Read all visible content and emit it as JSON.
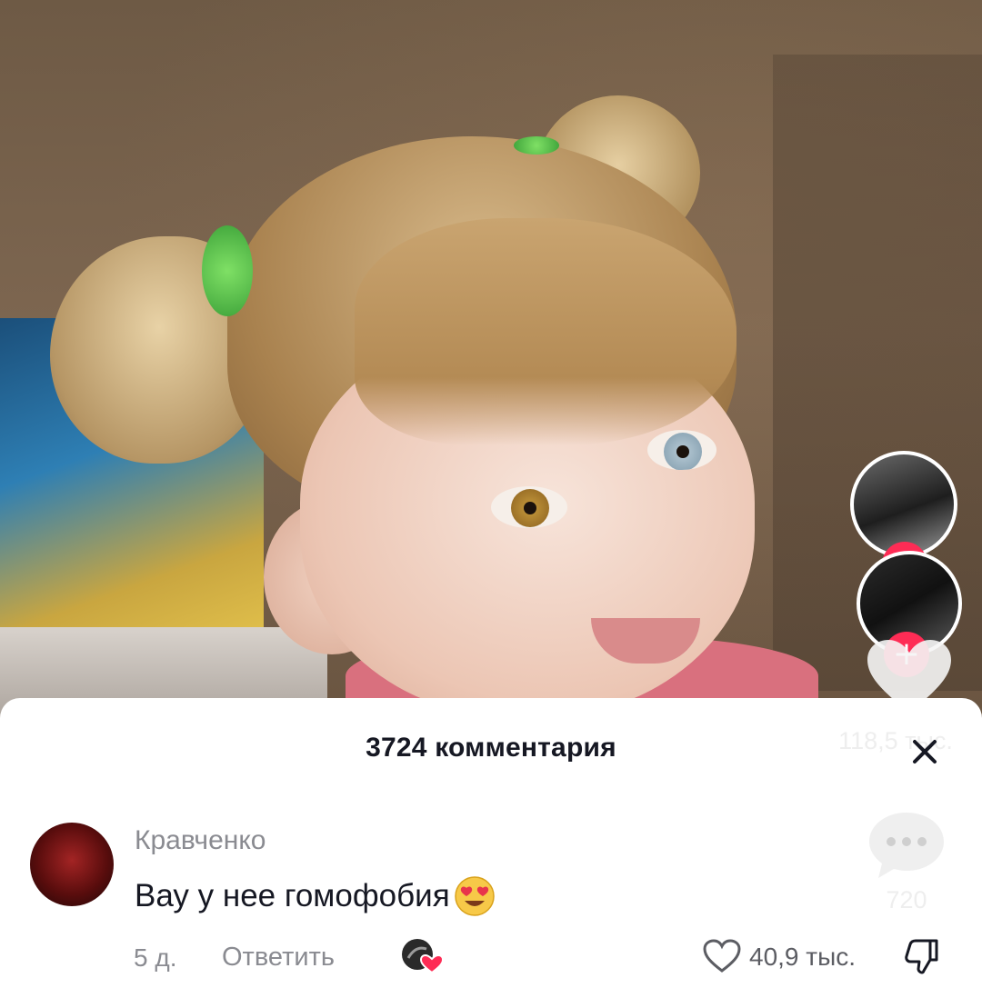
{
  "video": {
    "likes": "118,5 тыс.",
    "comments": "720"
  },
  "comments_sheet": {
    "title": "3724 комментария",
    "comment": {
      "author": "Кравченко",
      "text": "Вау у нее гомофобия",
      "emoji": "heart-eyes-emoji",
      "time": "5 д.",
      "reply_label": "Ответить",
      "like_count": "40,9 тыс."
    }
  },
  "colors": {
    "accent": "#fe2c55",
    "text_primary": "#161823",
    "text_secondary": "#8a8b91"
  },
  "icons": [
    "close-icon",
    "heart-icon",
    "comment-bubble-icon",
    "dislike-icon",
    "plus-icon"
  ]
}
